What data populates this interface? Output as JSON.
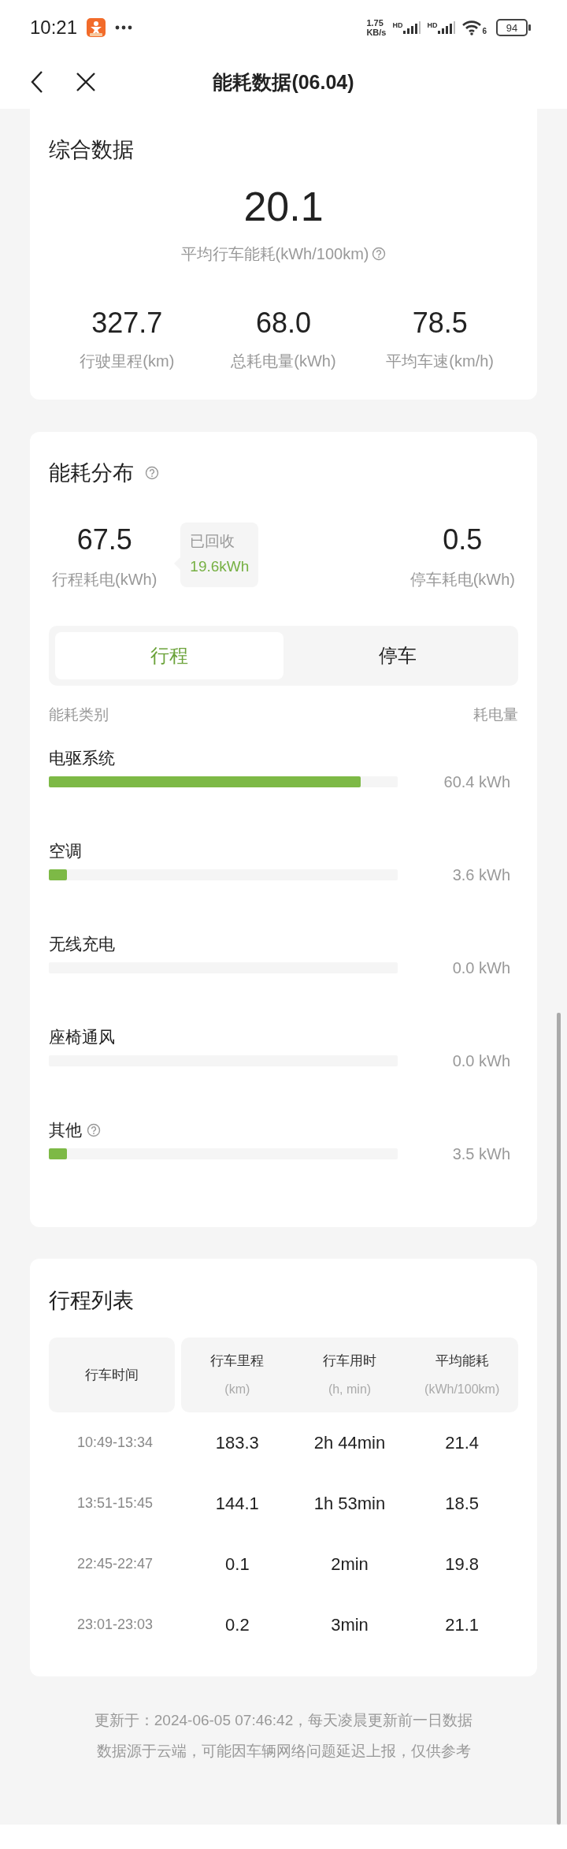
{
  "status_bar": {
    "time": "10:21",
    "net_speed": "1.75",
    "net_unit": "KB/s",
    "sims": [
      "HD",
      "HD"
    ],
    "wifi_label": "6",
    "battery": "94"
  },
  "nav": {
    "title": "能耗数据(06.04)"
  },
  "summary": {
    "title": "综合数据",
    "main": {
      "value": "20.1",
      "label": "平均行车能耗(kWh/100km)"
    },
    "stats": [
      {
        "value": "327.7",
        "label": "行驶里程(km)"
      },
      {
        "value": "68.0",
        "label": "总耗电量(kWh)"
      },
      {
        "value": "78.5",
        "label": "平均车速(km/h)"
      }
    ]
  },
  "distribution": {
    "title": "能耗分布",
    "trip": {
      "value": "67.5",
      "label": "行程耗电(kWh)"
    },
    "recovered": {
      "label": "已回收",
      "value": "19.6kWh"
    },
    "parking": {
      "value": "0.5",
      "label": "停车耗电(kWh)"
    },
    "tabs": [
      {
        "label": "行程",
        "selected": true
      },
      {
        "label": "停车",
        "selected": false
      }
    ],
    "header": {
      "category": "能耗类别",
      "amount": "耗电量"
    },
    "items": [
      {
        "name": "电驱系统",
        "help": false,
        "level": 0.895,
        "amount": "60.4 kWh"
      },
      {
        "name": "空调",
        "help": false,
        "level": 0.053,
        "amount": "3.6 kWh"
      },
      {
        "name": "无线充电",
        "help": false,
        "level": 0,
        "amount": "0.0 kWh"
      },
      {
        "name": "座椅通风",
        "help": false,
        "level": 0,
        "amount": "0.0 kWh"
      },
      {
        "name": "其他",
        "help": true,
        "level": 0.052,
        "amount": "3.5 kWh"
      }
    ]
  },
  "trips": {
    "title": "行程列表",
    "columns": [
      {
        "label": "行车时间"
      },
      {
        "label": "行车里程",
        "unit": "(km)"
      },
      {
        "label": "行车用时",
        "unit": "(h, min)"
      },
      {
        "label": "平均能耗",
        "unit": "(kWh/100km)"
      }
    ],
    "rows": [
      {
        "time": "10:49-13:34",
        "distance": "183.3",
        "duration": "2h 44min",
        "consumption": "21.4"
      },
      {
        "time": "13:51-15:45",
        "distance": "144.1",
        "duration": "1h 53min",
        "consumption": "18.5"
      },
      {
        "time": "22:45-22:47",
        "distance": "0.1",
        "duration": "2min",
        "consumption": "19.8"
      },
      {
        "time": "23:01-23:03",
        "distance": "0.2",
        "duration": "3min",
        "consumption": "21.1"
      }
    ]
  },
  "footer": {
    "lines": [
      "更新于：2024-06-05 07:46:42，每天凌晨更新前一日数据",
      "数据源于云端，可能因车辆网络问题延迟上报，仅供参考"
    ]
  }
}
